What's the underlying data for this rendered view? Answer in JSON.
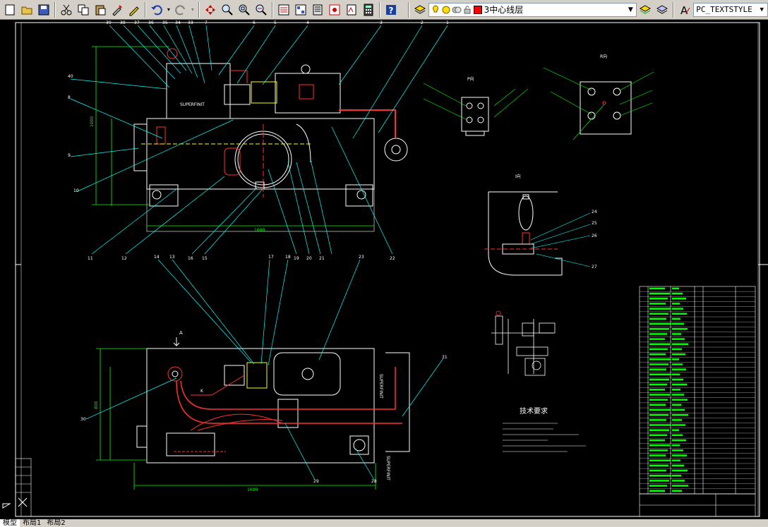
{
  "toolbar": {
    "layer_name": "3中心线层",
    "layer_color": "#ff0000",
    "text_style": "PC_TEXTSTYLE"
  },
  "drawing": {
    "title_tech": "技术要求",
    "view_a": "A",
    "view_k": "K",
    "view_p": "P向",
    "view_r": "R向",
    "view_i": "I向",
    "label_top": "SUPERFINIT",
    "label_mid": "SUPERFINIT",
    "label_bottom": "SUPERFINIT",
    "dim_top_w": "1600",
    "dim_bot_w": "1600",
    "dim_top_h": "1000",
    "dim_bot_h": "800"
  },
  "balloons_top": [
    "39",
    "38",
    "37",
    "36",
    "35",
    "34",
    "33",
    "7",
    "6",
    "5",
    "4",
    "3",
    "2",
    "1"
  ],
  "balloons_left": [
    "40",
    "8",
    "9",
    "10"
  ],
  "balloons_bottom_row": [
    "11",
    "12",
    "16",
    "15",
    "19",
    "20",
    "21",
    "22"
  ],
  "balloons_mid_row": [
    "14",
    "13",
    "17",
    "18",
    "23"
  ],
  "balloons_lower": [
    "30",
    "29",
    "28",
    "31"
  ],
  "balloons_detail": [
    "24",
    "25",
    "26",
    "27"
  ],
  "tabs": {
    "model": "模型",
    "layout1": "布局1",
    "layout2": "布局2"
  }
}
